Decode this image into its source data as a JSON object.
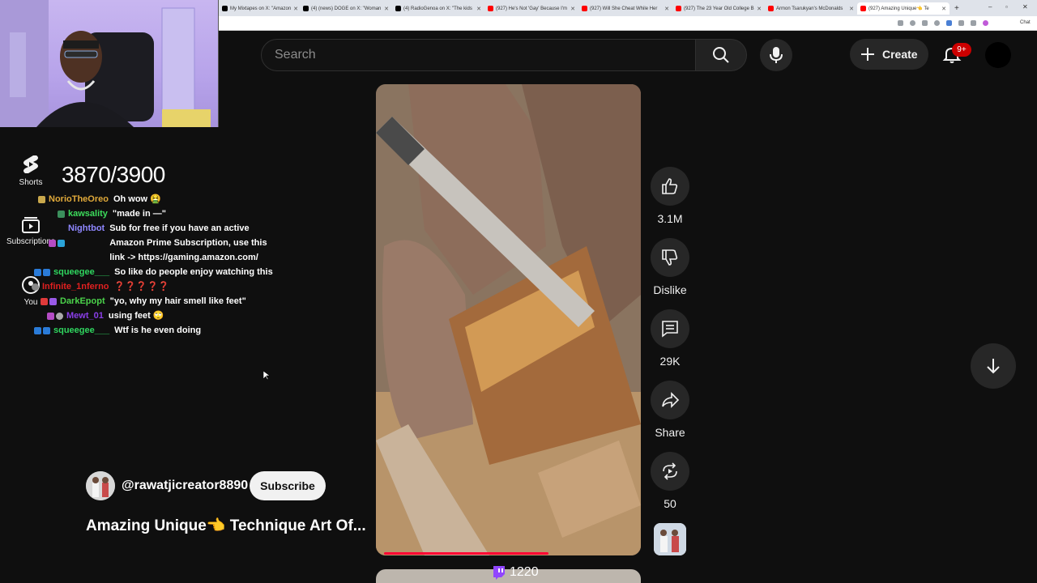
{
  "browser": {
    "tabs": [
      {
        "label": "My Mixtapes on X: \"Amazon",
        "color": "#000000"
      },
      {
        "label": "(4) (news) DOGE on X: \"Woman",
        "color": "#000000"
      },
      {
        "label": "(4) RadioGenoa on X: \"The kids",
        "color": "#000000"
      },
      {
        "label": "(927) He's Not 'Gay' Because I'm",
        "color": "#ff0000"
      },
      {
        "label": "(927) Will She Cheat While Her",
        "color": "#ff0000"
      },
      {
        "label": "(927) The 23 Year Old College B",
        "color": "#ff0000"
      },
      {
        "label": "Armon Tsarukyan's McDonalds",
        "color": "#ff0000"
      },
      {
        "label": "(927) Amazing Unique👈 Te",
        "color": "#ff0000"
      }
    ],
    "active_tab_index": 7,
    "new_tab": "+",
    "toolbar_chat": "Chat"
  },
  "header": {
    "search_placeholder": "Search",
    "create_label": "Create",
    "notification_badge": "9+"
  },
  "sidebar": {
    "items": [
      {
        "label": "Shorts",
        "icon": "shorts-icon"
      },
      {
        "label": "Subscriptions",
        "icon": "subscriptions-icon"
      },
      {
        "label": "You",
        "icon": "you-icon"
      }
    ]
  },
  "overlay": {
    "goal": "3870/3900",
    "viewer_count": "1220",
    "chat": [
      {
        "user": "NorioTheOreo",
        "color": "#e0a93a",
        "msg": "Oh wow 🤮"
      },
      {
        "user": "kawsality",
        "color": "#3ddc5c",
        "msg": "\"made in —\""
      },
      {
        "user": "Nightbot",
        "color": "#8f87ff",
        "msg": "Sub for free if you have an active Amazon Prime Subscription, use this link -> https://gaming.amazon.com/"
      },
      {
        "user": "squeegee___",
        "color": "#2fd65f",
        "msg": "So like do people enjoy watching this"
      },
      {
        "user": "Infinite_1nferno",
        "color": "#e02020",
        "msg": "❓❓❓❓❓"
      },
      {
        "user": "DarkEpopt",
        "color": "#4bd34b",
        "msg": "\"yo, why my hair smell like feet\""
      },
      {
        "user": "Mewt_01",
        "color": "#8a3ee8",
        "msg": "using feet 🙄"
      },
      {
        "user": "squeegee___",
        "color": "#2fd65f",
        "msg": "Wtf is he even doing"
      }
    ]
  },
  "short": {
    "channel": "@rawatjicreator8890",
    "subscribe_label": "Subscribe",
    "title": "Amazing Unique👈 Technique Art Of...",
    "progress": 0.62,
    "actions": {
      "like": "3.1M",
      "dislike": "Dislike",
      "comments": "29K",
      "share": "Share",
      "remix": "50"
    }
  },
  "colors": {
    "background": "#0f0f0f",
    "accent_red": "#ff0033",
    "button_bg": "#272727"
  }
}
